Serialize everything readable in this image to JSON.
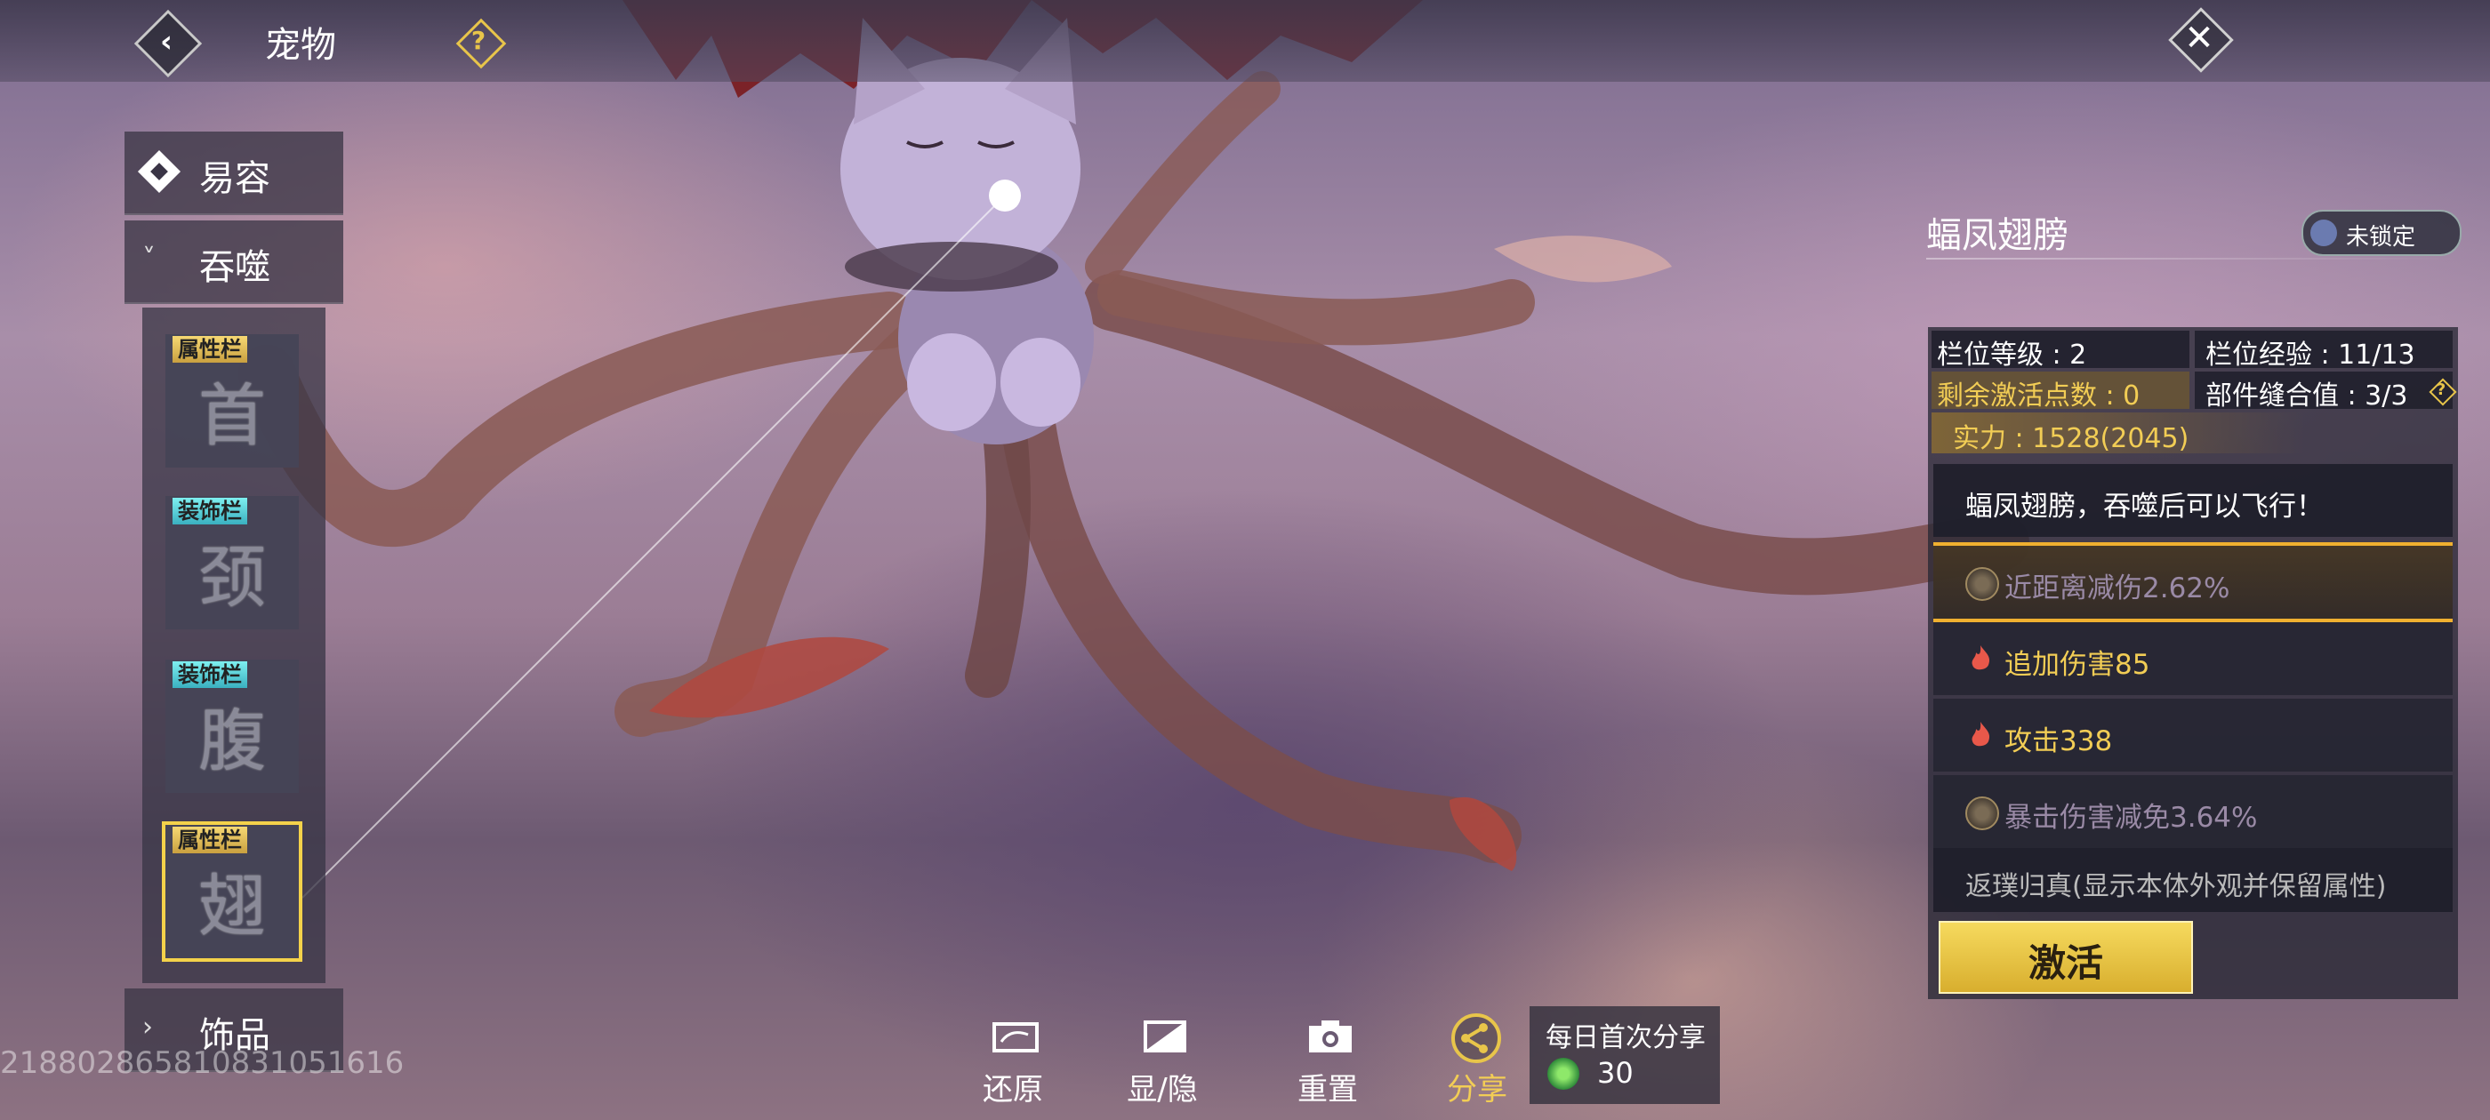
{
  "header": {
    "title": "宠物"
  },
  "sidebar": {
    "disguise": "易容",
    "devour": "吞噬",
    "ornament": "饰品",
    "slots": [
      {
        "tag": "属性栏",
        "tag_type": "attr",
        "glyph": "首"
      },
      {
        "tag": "装饰栏",
        "tag_type": "deco",
        "glyph": "颈"
      },
      {
        "tag": "装饰栏",
        "tag_type": "deco",
        "glyph": "腹"
      },
      {
        "tag": "属性栏",
        "tag_type": "attr",
        "glyph": "翅",
        "selected": true
      }
    ]
  },
  "uid": "21880286581083105161​6",
  "part": {
    "name": "蝠凤翅膀",
    "lock_label": "未锁定",
    "slot_level": "栏位等级 : 2",
    "slot_exp": "栏位经验 : 11/13",
    "remaining_points": "剩余激活点数 : 0",
    "stitch_value": "部件缝合值 : 3/3",
    "power": "实力 : 1528(2045)",
    "description": "蝠凤翅膀，吞噬后可以飞行！",
    "attributes": [
      {
        "icon": "swirl-icon",
        "text": "近距离减伤2.62%",
        "style": "dim",
        "highlight": true
      },
      {
        "icon": "fire-icon",
        "text": "追加伤害85",
        "style": "fire"
      },
      {
        "icon": "fire-icon",
        "text": "攻击338",
        "style": "fire"
      },
      {
        "icon": "swirl-icon",
        "text": "暴击伤害减免3.64%",
        "style": "dim"
      }
    ],
    "revert_text": "返璞归真(显示本体外观并保留属性)",
    "activate_label": "激活"
  },
  "toolbar": {
    "restore": "还原",
    "toggle": "显/隐",
    "reset": "重置",
    "share": "分享",
    "daily_share": "每日首次分享",
    "reward_count": "30"
  },
  "colors": {
    "accent_gold": "#f2cd55",
    "deco_tag": "#7ef0f0",
    "attr_tag": "#f6d873"
  }
}
